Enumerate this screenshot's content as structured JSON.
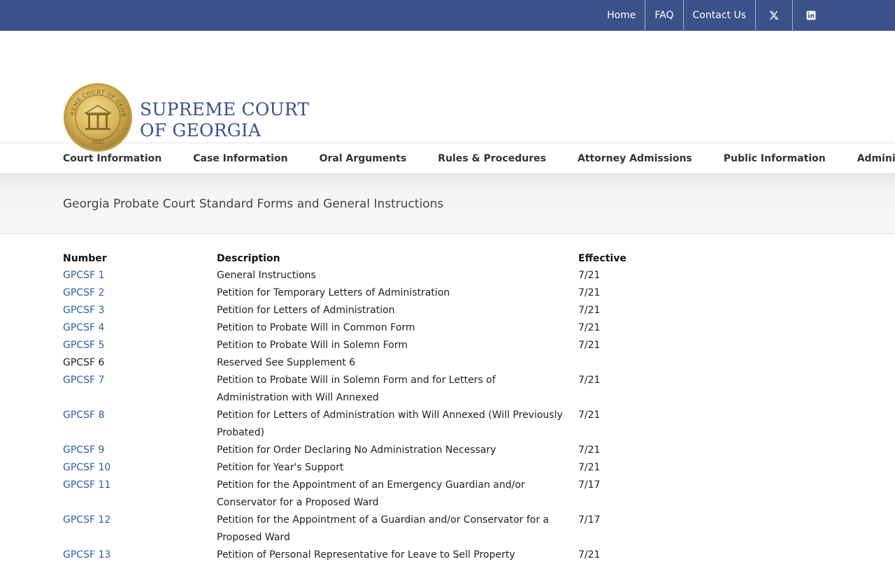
{
  "topbar": {
    "links": [
      "Home",
      "FAQ",
      "Contact Us"
    ],
    "social": [
      "x-icon",
      "linkedin-icon"
    ],
    "color": "#3a5189"
  },
  "header": {
    "seal_text": "SUPREME COURT OF GEORGIA",
    "seal_year": "1845",
    "brand_line1": "SUPREME COURT",
    "brand_line2": "OF GEORGIA"
  },
  "nav": {
    "items": [
      "Court Information",
      "Case Information",
      "Oral Arguments",
      "Rules & Procedures",
      "Attorney Admissions",
      "Public Information",
      "Administrative"
    ]
  },
  "page_title": "Georgia Probate Court Standard Forms and General Instructions",
  "table": {
    "headers": [
      "Number",
      "Description",
      "Effective"
    ],
    "rows": [
      {
        "number": "GPCSF 1",
        "link": true,
        "description": "General Instructions",
        "effective": "7/21"
      },
      {
        "number": "GPCSF 2",
        "link": true,
        "description": "Petition for Temporary Letters of Administration",
        "effective": "7/21"
      },
      {
        "number": "GPCSF 3",
        "link": true,
        "description": "Petition for Letters of Administration",
        "effective": "7/21"
      },
      {
        "number": "GPCSF 4",
        "link": true,
        "description": "Petition to Probate Will in Common Form",
        "effective": "7/21"
      },
      {
        "number": "GPCSF 5",
        "link": true,
        "description": "Petition to Probate Will in Solemn Form",
        "effective": "7/21"
      },
      {
        "number": "GPCSF 6",
        "link": false,
        "description": "Reserved See Supplement 6",
        "effective": ""
      },
      {
        "number": "GPCSF 7",
        "link": true,
        "description": "Petition to Probate Will in Solemn Form and for Letters of Administration with Will Annexed",
        "effective": "7/21"
      },
      {
        "number": "GPCSF 8",
        "link": true,
        "description": "Petition for Letters of Administration with Will Annexed (Will Previously Probated)",
        "effective": "7/21"
      },
      {
        "number": "GPCSF 9",
        "link": true,
        "description": "Petition for Order Declaring No Administration Necessary",
        "effective": "7/21"
      },
      {
        "number": "GPCSF 10",
        "link": true,
        "description": "Petition for Year's Support",
        "effective": "7/21"
      },
      {
        "number": "GPCSF 11",
        "link": true,
        "description": "Petition for the Appointment of an Emergency Guardian and/or Conservator for a Proposed Ward",
        "effective": "7/17"
      },
      {
        "number": "GPCSF 12",
        "link": true,
        "description": "Petition for the Appointment of a Guardian and/or Conservator for a Proposed Ward",
        "effective": "7/17"
      },
      {
        "number": "GPCSF 13",
        "link": true,
        "description": "Petition of Personal Representative for Leave to Sell Property",
        "effective": "7/21"
      }
    ]
  }
}
